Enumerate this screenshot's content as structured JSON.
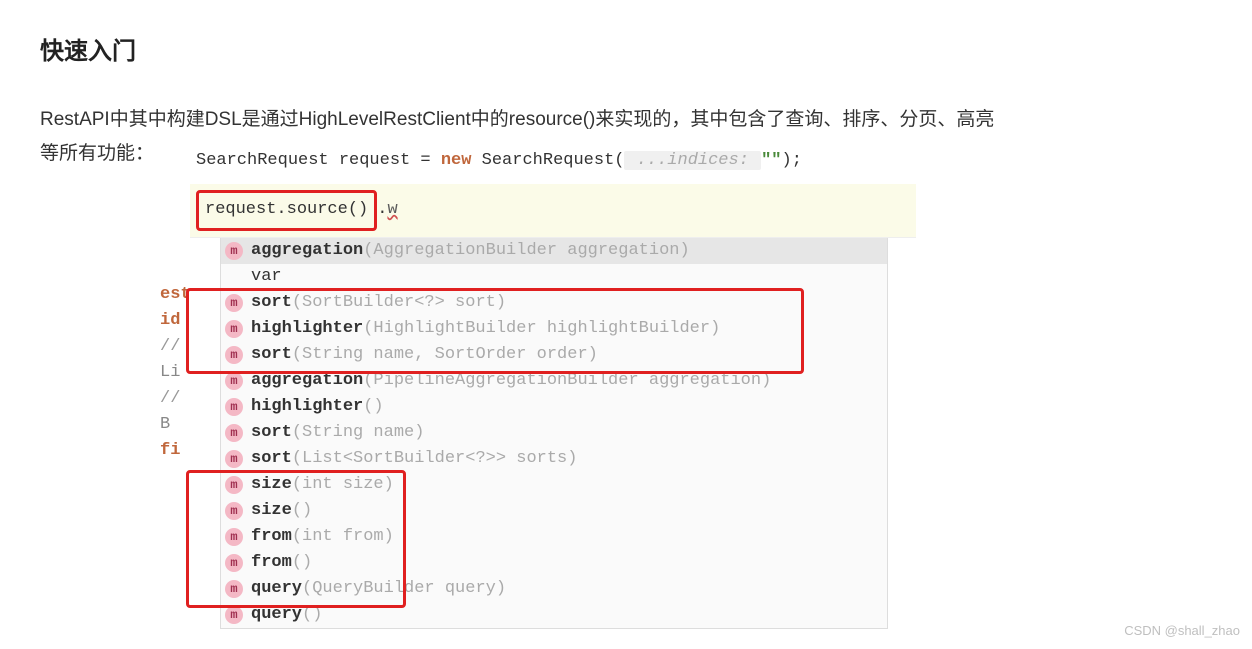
{
  "heading": "快速入门",
  "paragraph_part1": "RestAPI中其中构建DSL是通过HighLevelRestClient中的resource()来实现的，其中包含了查询、排序、分页、高亮",
  "paragraph_part2": "等所有功能：",
  "code": {
    "line1_a": "SearchRequest request = ",
    "line1_new": "new",
    "line1_b": " SearchRequest(",
    "line1_hint": " ...indices: ",
    "line1_str": "\"\"",
    "line1_c": ");",
    "line2_box": "request.source()",
    "line2_dot": ".",
    "line2_err": "w"
  },
  "gutter": [
    "",
    "",
    "est",
    "id",
    "//",
    "Li",
    "",
    "//",
    "B",
    "",
    "fi",
    "",
    "",
    ""
  ],
  "suggestions": [
    {
      "type": "m",
      "name": "aggregation",
      "params": "(AggregationBuilder aggregation)",
      "selected": true
    },
    {
      "type": "var",
      "name": "var",
      "params": ""
    },
    {
      "type": "m",
      "name": "sort",
      "params": "(SortBuilder<?> sort)"
    },
    {
      "type": "m",
      "name": "highlighter",
      "params": "(HighlightBuilder highlightBuilder)"
    },
    {
      "type": "m",
      "name": "sort",
      "params": "(String name, SortOrder order)"
    },
    {
      "type": "m",
      "name": "aggregation",
      "params": "(PipelineAggregationBuilder aggregation)"
    },
    {
      "type": "m",
      "name": "highlighter",
      "params": "()"
    },
    {
      "type": "m",
      "name": "sort",
      "params": "(String name)"
    },
    {
      "type": "m",
      "name": "sort",
      "params": "(List<SortBuilder<?>> sorts)"
    },
    {
      "type": "m",
      "name": "size",
      "params": "(int size)"
    },
    {
      "type": "m",
      "name": "size",
      "params": "()"
    },
    {
      "type": "m",
      "name": "from",
      "params": "(int from)"
    },
    {
      "type": "m",
      "name": "from",
      "params": "()"
    },
    {
      "type": "m",
      "name": "query",
      "params": "(QueryBuilder query)"
    },
    {
      "type": "m",
      "name": "query",
      "params": "()"
    }
  ],
  "watermark": "CSDN @shall_zhao"
}
